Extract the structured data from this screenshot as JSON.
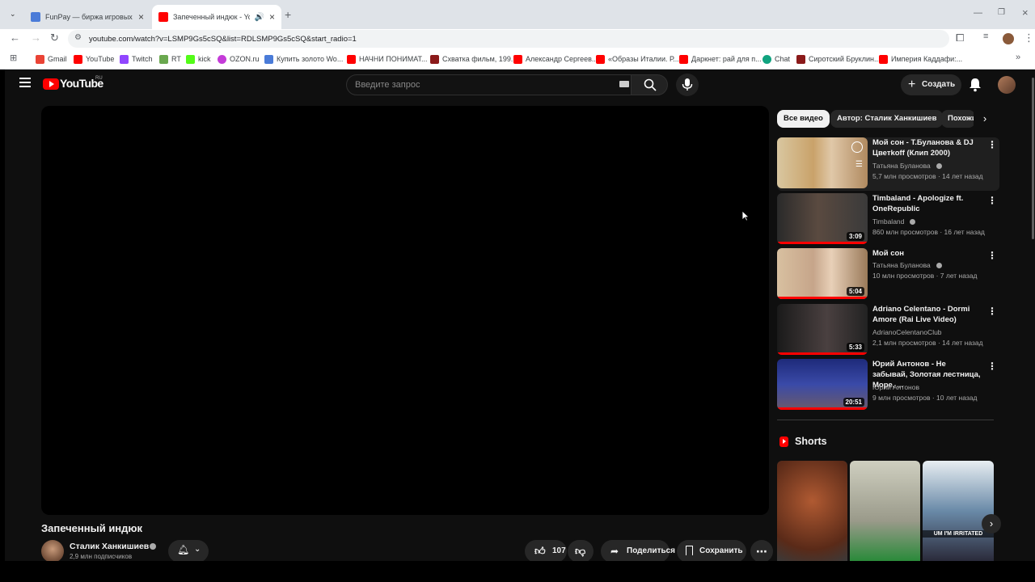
{
  "browser": {
    "tabs": [
      {
        "title": "FunPay — биржа игровых цен",
        "favicon_color": "#4a7bd8"
      },
      {
        "title": "Запеченный индюк - YouTube",
        "favicon_color": "#ff0000"
      }
    ],
    "url": "youtube.com/watch?v=LSMP9Gs5cSQ&list=RDLSMP9Gs5cSQ&start_radio=1",
    "bookmarks": [
      {
        "label": "Gmail",
        "color": "#ea4335"
      },
      {
        "label": "YouTube",
        "color": "#ff0000"
      },
      {
        "label": "Twitch",
        "color": "#9146ff"
      },
      {
        "label": "RT",
        "color": "#6aa84f"
      },
      {
        "label": "kick",
        "color": "#53fc18"
      },
      {
        "label": "OZON.ru",
        "color": "#c43bd8"
      },
      {
        "label": "Купить золото Wo...",
        "color": "#4a7bd8"
      },
      {
        "label": "НАЧНИ ПОНИМАТ...",
        "color": "#ff0000"
      },
      {
        "label": "Схватка фильм, 199...",
        "color": "#8b1a1a"
      },
      {
        "label": "Александр Сергеев...",
        "color": "#ff0000"
      },
      {
        "label": "«Образы Италии. Р...",
        "color": "#ff0000"
      },
      {
        "label": "Даркнет: рай для п...",
        "color": "#ff0000"
      },
      {
        "label": "Chat",
        "color": "#10a37f"
      },
      {
        "label": "Сиротский Бруклин...",
        "color": "#8b1a1a"
      },
      {
        "label": "Империя Каддафи:...",
        "color": "#ff0000"
      }
    ]
  },
  "youtube": {
    "logo": "YouTube",
    "region": "RU",
    "search_placeholder": "Введите запрос",
    "create_label": "Создать",
    "video_title": "Запеченный индюк",
    "channel_name": "Сталик Ханкишиев",
    "subscribers": "2,9 млн подписчиков",
    "likes": "107",
    "share_label": "Поделиться",
    "save_label": "Сохранить",
    "chips": [
      "Все видео",
      "Автор: Сталик Ханкишиев",
      "Похожие"
    ],
    "recommendations": [
      {
        "title": "Мой сон - Т.Буланова & DJ Цветkoff (Клип 2000)",
        "channel": "Татьяна Буланова",
        "meta": "5,7 млн просмотров · 14 лет назад",
        "duration": "",
        "thumb_color": "#c9a26a",
        "verified": true
      },
      {
        "title": "Timbaland - Apologize ft. OneRepublic",
        "channel": "Timbaland",
        "meta": "860 млн просмотров · 16 лет назад",
        "duration": "3:09",
        "thumb_color": "#3b3b3b",
        "verified": true
      },
      {
        "title": "Мой сон",
        "channel": "Татьяна Буланова",
        "meta": "10 млн просмотров · 7 лет назад",
        "duration": "5:04",
        "thumb_color": "#c6a58a",
        "verified": true
      },
      {
        "title": "Adriano Celentano - Dormi Amore (Rai Live Video)",
        "channel": "AdrianoCelentanoClub",
        "meta": "2,1 млн просмотров · 14 лет назад",
        "duration": "5:33",
        "thumb_color": "#2a2a2a",
        "verified": false
      },
      {
        "title": "Юрий Антонов - Не забывай, Золотая лестница, Море, ...",
        "channel": "Юрий Антонов",
        "meta": "9 млн просмотров · 10 лет назад",
        "duration": "20:51",
        "thumb_color": "#2b3a8a",
        "verified": false
      }
    ],
    "shorts_label": "Shorts",
    "shorts": [
      {
        "caption": "",
        "color": "#7a3a22"
      },
      {
        "caption": "",
        "color": "#9a9a8a"
      },
      {
        "caption": "UM I'M IRRITATED",
        "color": "#6a8aa8"
      }
    ]
  }
}
